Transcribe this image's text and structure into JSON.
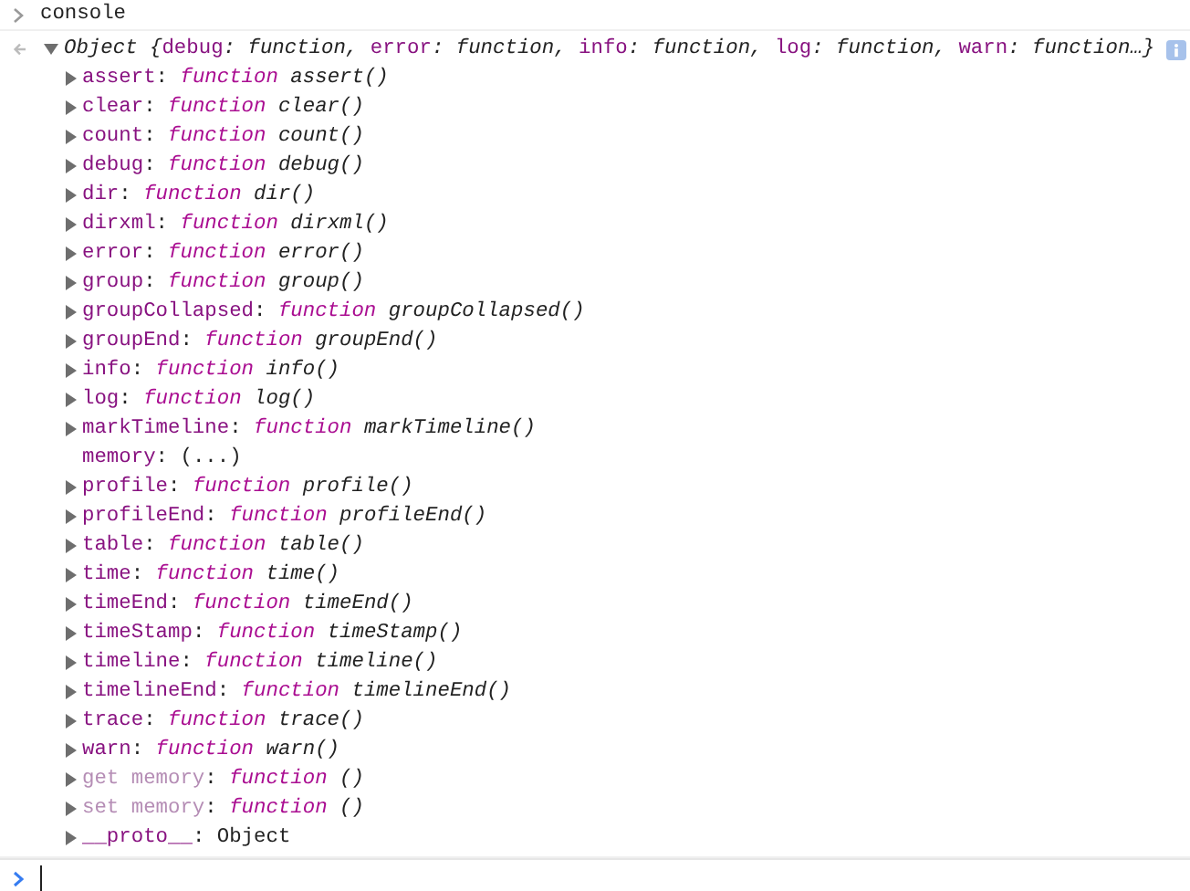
{
  "command": "console",
  "summary": [
    {
      "text": "Object {",
      "kind": "plain"
    },
    {
      "text": "debug",
      "kind": "key"
    },
    {
      "text": ": function, ",
      "kind": "plain"
    },
    {
      "text": "error",
      "kind": "key"
    },
    {
      "text": ": function, ",
      "kind": "plain"
    },
    {
      "text": "info",
      "kind": "key"
    },
    {
      "text": ": function, ",
      "kind": "plain"
    },
    {
      "text": "log",
      "kind": "key"
    },
    {
      "text": ": function, ",
      "kind": "plain"
    },
    {
      "text": "warn",
      "kind": "key"
    },
    {
      "text": ": function…}",
      "kind": "plain"
    }
  ],
  "expanded": true,
  "properties": [
    {
      "sep": ":",
      "name": "assert",
      "kind": "function",
      "keyword": "function",
      "value": "assert()",
      "expandable": true,
      "dimmed": false
    },
    {
      "sep": ":",
      "name": "clear",
      "kind": "function",
      "keyword": "function",
      "value": "clear()",
      "expandable": true,
      "dimmed": false
    },
    {
      "sep": ":",
      "name": "count",
      "kind": "function",
      "keyword": "function",
      "value": "count()",
      "expandable": true,
      "dimmed": false
    },
    {
      "sep": ":",
      "name": "debug",
      "kind": "function",
      "keyword": "function",
      "value": "debug()",
      "expandable": true,
      "dimmed": false
    },
    {
      "sep": ":",
      "name": "dir",
      "kind": "function",
      "keyword": "function",
      "value": "dir()",
      "expandable": true,
      "dimmed": false
    },
    {
      "sep": ":",
      "name": "dirxml",
      "kind": "function",
      "keyword": "function",
      "value": "dirxml()",
      "expandable": true,
      "dimmed": false
    },
    {
      "sep": ":",
      "name": "error",
      "kind": "function",
      "keyword": "function",
      "value": "error()",
      "expandable": true,
      "dimmed": false
    },
    {
      "sep": ":",
      "name": "group",
      "kind": "function",
      "keyword": "function",
      "value": "group()",
      "expandable": true,
      "dimmed": false
    },
    {
      "sep": ":",
      "name": "groupCollapsed",
      "kind": "function",
      "keyword": "function",
      "value": "groupCollapsed()",
      "expandable": true,
      "dimmed": false
    },
    {
      "sep": ":",
      "name": "groupEnd",
      "kind": "function",
      "keyword": "function",
      "value": "groupEnd()",
      "expandable": true,
      "dimmed": false
    },
    {
      "sep": ":",
      "name": "info",
      "kind": "function",
      "keyword": "function",
      "value": "info()",
      "expandable": true,
      "dimmed": false
    },
    {
      "sep": ":",
      "name": "log",
      "kind": "function",
      "keyword": "function",
      "value": "log()",
      "expandable": true,
      "dimmed": false
    },
    {
      "sep": ":",
      "name": "markTimeline",
      "kind": "function",
      "keyword": "function",
      "value": "markTimeline()",
      "expandable": true,
      "dimmed": false
    },
    {
      "sep": ":",
      "name": "memory",
      "kind": "plain",
      "value": "(...)",
      "expandable": false,
      "dimmed": false
    },
    {
      "sep": ":",
      "name": "profile",
      "kind": "function",
      "keyword": "function",
      "value": "profile()",
      "expandable": true,
      "dimmed": false
    },
    {
      "sep": ":",
      "name": "profileEnd",
      "kind": "function",
      "keyword": "function",
      "value": "profileEnd()",
      "expandable": true,
      "dimmed": false
    },
    {
      "sep": ":",
      "name": "table",
      "kind": "function",
      "keyword": "function",
      "value": "table()",
      "expandable": true,
      "dimmed": false
    },
    {
      "sep": ":",
      "name": "time",
      "kind": "function",
      "keyword": "function",
      "value": "time()",
      "expandable": true,
      "dimmed": false
    },
    {
      "sep": ":",
      "name": "timeEnd",
      "kind": "function",
      "keyword": "function",
      "value": "timeEnd()",
      "expandable": true,
      "dimmed": false
    },
    {
      "sep": ":",
      "name": "timeStamp",
      "kind": "function",
      "keyword": "function",
      "value": "timeStamp()",
      "expandable": true,
      "dimmed": false
    },
    {
      "sep": ":",
      "name": "timeline",
      "kind": "function",
      "keyword": "function",
      "value": "timeline()",
      "expandable": true,
      "dimmed": false
    },
    {
      "sep": ":",
      "name": "timelineEnd",
      "kind": "function",
      "keyword": "function",
      "value": "timelineEnd()",
      "expandable": true,
      "dimmed": false
    },
    {
      "sep": ":",
      "name": "trace",
      "kind": "function",
      "keyword": "function",
      "value": "trace()",
      "expandable": true,
      "dimmed": false
    },
    {
      "sep": ":",
      "name": "warn",
      "kind": "function",
      "keyword": "function",
      "value": "warn()",
      "expandable": true,
      "dimmed": false
    },
    {
      "sep": ":",
      "name": "get memory",
      "kind": "function",
      "keyword": "function",
      "value": "()",
      "expandable": true,
      "dimmed": true
    },
    {
      "sep": ":",
      "name": "set memory",
      "kind": "function",
      "keyword": "function",
      "value": "()",
      "expandable": true,
      "dimmed": true
    },
    {
      "sep": ":",
      "name": "__proto__",
      "kind": "plain",
      "value": "Object",
      "expandable": true,
      "dimmed": false
    }
  ]
}
